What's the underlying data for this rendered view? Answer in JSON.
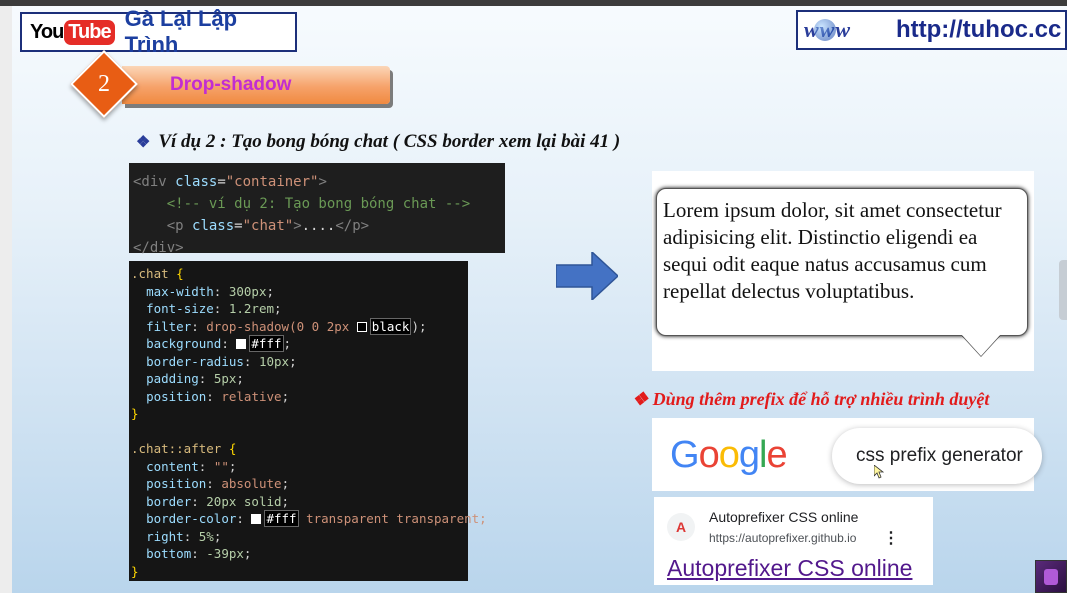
{
  "header": {
    "youtube_you": "You",
    "youtube_tube": "Tube",
    "channel_name": "Gà Lại Lập Trình",
    "globe_text": "www",
    "website_url": "http://tuhoc.cc"
  },
  "section": {
    "number": "2",
    "title": "Drop-shadow"
  },
  "example": {
    "bullet": "❖",
    "title": "Ví dụ 2 :  Tạo bong bóng chat ( CSS border xem lại bài 41 )"
  },
  "html_code": {
    "line1_tag_open": "<div",
    "line1_attr": "class",
    "line1_value": "\"container\"",
    "line2_comment": "<!-- ví dụ 2: Tạo bong bóng chat -->",
    "line3_tag_open": "<p",
    "line3_attr": "class",
    "line3_value": "\"chat\"",
    "line3_text": "....",
    "line3_close": "</p>",
    "line4_close": "</div>"
  },
  "css_code": {
    "selector1": ".chat",
    "rules1": [
      {
        "prop": "max-width",
        "value": "300px"
      },
      {
        "prop": "font-size",
        "value": "1.2rem"
      },
      {
        "prop": "filter",
        "value_prefix": "drop-shadow(0 0 2px ",
        "value_highlight": "black",
        "value_suffix": ");"
      },
      {
        "prop": "background",
        "value_highlight": "#fff",
        "value_suffix": ";"
      },
      {
        "prop": "border-radius",
        "value": "10px"
      },
      {
        "prop": "padding",
        "value": "5px"
      },
      {
        "prop": "position",
        "value": "relative"
      }
    ],
    "selector2": ".chat::after",
    "rules2": [
      {
        "prop": "content",
        "value": "\"\""
      },
      {
        "prop": "position",
        "value": "absolute"
      },
      {
        "prop": "border",
        "value": "20px solid"
      },
      {
        "prop": "border-color",
        "value_highlight": "#fff",
        "value_suffix": " transparent transparent;"
      },
      {
        "prop": "right",
        "value": "5%"
      },
      {
        "prop": "bottom",
        "value": "-39px"
      }
    ]
  },
  "preview": {
    "chat_text": "Lorem ipsum dolor, sit amet consectetur adipisicing elit. Distinctio eligendi ea sequi odit eaque natus accusamus cum repellat delectus voluptatibus."
  },
  "prefix_note": {
    "bullet": "❖",
    "text": "Dùng thêm prefix để hỗ trợ nhiều trình duyệt"
  },
  "google": {
    "logo_letters": [
      "G",
      "o",
      "o",
      "g",
      "l",
      "e"
    ],
    "search_query": "css prefix generator"
  },
  "result": {
    "site_name": "Autoprefixer CSS online",
    "site_url": "https://autoprefixer.github.io",
    "more_label": "⋮",
    "favicon_glyph": "A",
    "link_text": "Autoprefixer CSS online"
  },
  "colors": {
    "brand_blue": "#1c3fa0",
    "section_orange": "#f08a40",
    "section_title": "#c22dd2",
    "note_red": "#e21b1b",
    "arrow_blue": "#4472c4"
  }
}
